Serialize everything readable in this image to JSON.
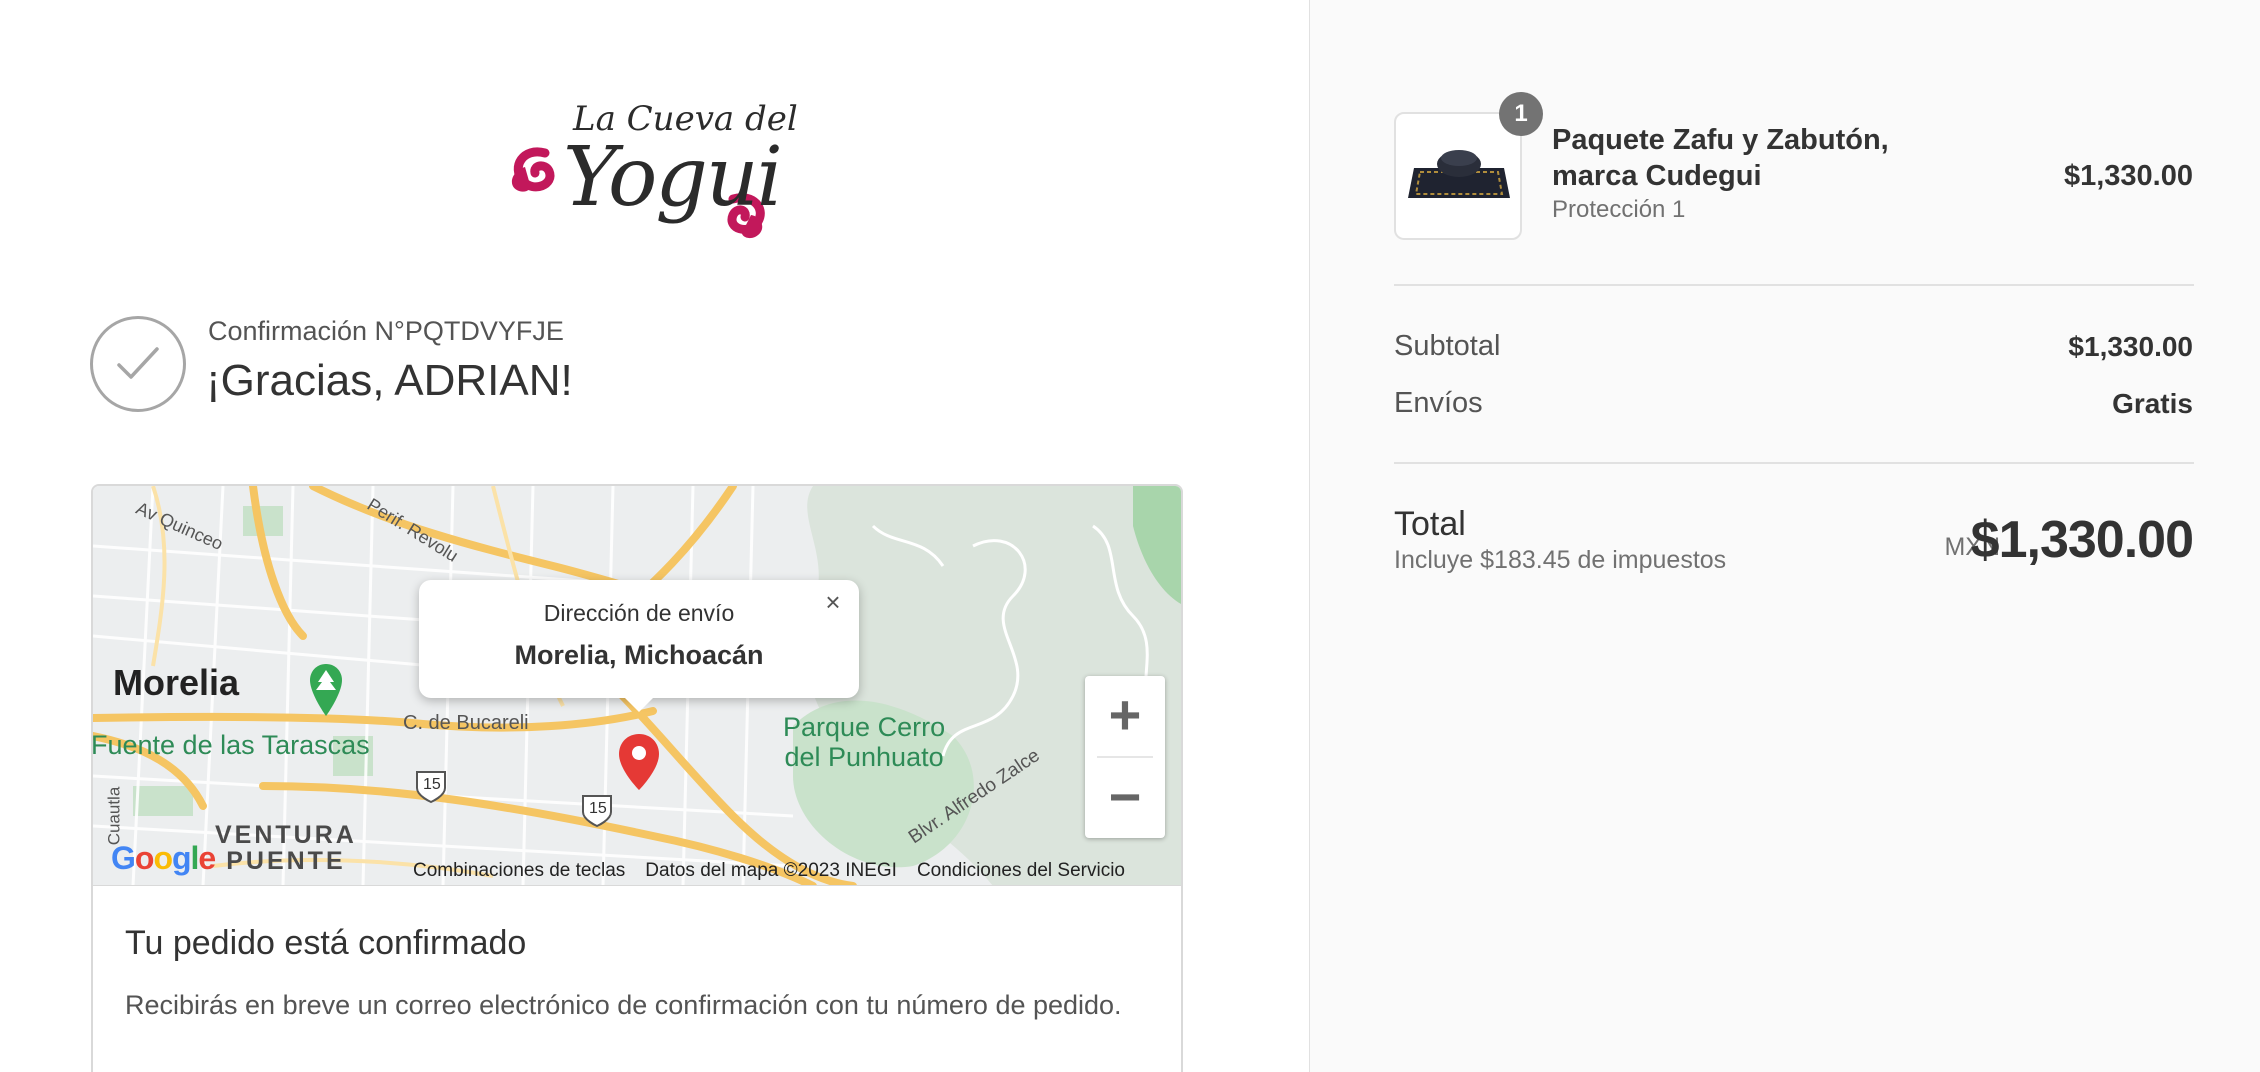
{
  "brand": {
    "logo_line1": "La Cueva del",
    "logo_line2": "Yogui",
    "colors": {
      "accent": "#c2185b",
      "ink": "#2b2b2b"
    }
  },
  "confirmation": {
    "number_label": "Confirmación N°PQTDVYFJE",
    "greeting": "¡Gracias, ADRIAN!",
    "icon": "checkmark-icon"
  },
  "map": {
    "popup_title": "Dirección de envío",
    "popup_address": "Morelia, Michoacán",
    "labels": {
      "city": "Morelia",
      "fuente": "Fuente de las Tarascas",
      "parque_line1": "Parque Cerro",
      "parque_line2": "del Punhuato",
      "bucareli": "C. de Bucareli",
      "quinceo": "Av Quinceo",
      "perif": "Perif. Revolu",
      "alfredo": "Blvr. Alfredo Zalce",
      "cuautla": "Cuautla",
      "ventura_line1": "VENTURA",
      "ventura_line2": "PUENTE",
      "highway_1": "15",
      "highway_2": "15",
      "google": "Google"
    },
    "attribution": {
      "shortcuts": "Combinaciones de teclas",
      "data": "Datos del mapa ©2023 INEGI",
      "terms": "Condiciones del Servicio"
    },
    "zoom_in": "+",
    "zoom_out": "−",
    "close": "×"
  },
  "order_status": {
    "title": "Tu pedido está confirmado",
    "message": "Recibirás en breve un correo electrónico de confirmación con tu número de pedido."
  },
  "summary": {
    "items": [
      {
        "name": "Paquete Zafu y Zabutón, marca Cudegui",
        "variant": "Protección 1",
        "price": "$1,330.00",
        "quantity": "1"
      }
    ],
    "subtotal_label": "Subtotal",
    "subtotal_value": "$1,330.00",
    "shipping_label": "Envíos",
    "shipping_value": "Gratis",
    "total_label": "Total",
    "tax_note": "Incluye $183.45 de impuestos",
    "currency": "MXN",
    "total_value": "$1,330.00"
  }
}
